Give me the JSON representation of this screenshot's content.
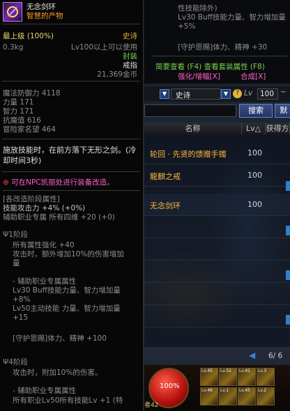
{
  "tooltip": {
    "item_name": "无念剑环",
    "item_subtitle": "智慧的产物",
    "grade_label": "最上级 (100%)",
    "rarity": "史诗",
    "weight": "0.3kg",
    "level_req": "Lv100以上可以使用",
    "sealed": "封装",
    "slot_type": "戒指",
    "price": "21,369金币",
    "stats": [
      {
        "label": "魔法防御力",
        "value": "4118"
      },
      {
        "label": "力量",
        "value": "171"
      },
      {
        "label": "智力",
        "value": "171"
      },
      {
        "label": "抗魔值",
        "value": "616"
      },
      {
        "label": "冒险家名望",
        "value": "464"
      }
    ],
    "skill_desc": "施放技能时，在前方落下无形之剑。(冷却时间3秒)",
    "upgrade_note": "可在NPC凯丽处进行装备改造。",
    "stage_header": "[各改造阶段属性]",
    "stage_line1": "技能攻击力 +4% (+0%)",
    "stage_line2": "辅助职业专属 所有四维 +20 (+0)",
    "tier1_title": "1阶段",
    "tier1_lines": [
      "所有属性强化 +40",
      "攻击时，额外增加10%的伤害增加",
      "量",
      "",
      "- 辅助职业专属属性",
      "Lv30 Buff技能力量、智力增加量",
      "+8%",
      "Lv50主动技能 力量、智力增加量",
      "+15",
      "",
      "[守护恩赐]体力、精神 +100"
    ],
    "tier4_title": "4阶段",
    "tier4_lines": [
      "攻击时，附加10%的伤害。",
      "",
      "- 辅助职业专属属性",
      "所有职业Lv50所有技能Lv +1 (特"
    ]
  },
  "compare_panel": {
    "lines": [
      "性技能除外)",
      "Lv30 Buff技能力量、智力增加量",
      "+5%",
      "",
      "[守护恩赐]体力、精神 +30"
    ],
    "link1": "简要查看 (F4) 查看套装属性 (F8)",
    "link2": "强化/增幅[X]",
    "link3": "合成[X]"
  },
  "filters": {
    "rarity_value": "史诗",
    "lv_label": "Lv",
    "lv_value": "100",
    "help": "?"
  },
  "search": {
    "button": "搜索",
    "button2": "默"
  },
  "table": {
    "headers": [
      "名称",
      "Lv△",
      "获得方"
    ],
    "rows": [
      {
        "name": "轮回 · 先贤的馈赠手镯",
        "lv": "100"
      },
      {
        "name": "龍麒之戒",
        "lv": "100"
      },
      {
        "name": "无念剑环",
        "lv": "100"
      },
      {
        "name": "",
        "lv": ""
      },
      {
        "name": "",
        "lv": ""
      },
      {
        "name": "",
        "lv": ""
      },
      {
        "name": "",
        "lv": ""
      },
      {
        "name": "",
        "lv": ""
      },
      {
        "name": "",
        "lv": ""
      }
    ]
  },
  "pager": {
    "text": "6/ 6"
  },
  "hud": {
    "hp": "100%",
    "slots": [
      "Lv.45",
      "Lv.52",
      "Lv.41",
      "Lv.3",
      "Lv.46",
      "Lv.1",
      "Lv.45",
      "Lv.2"
    ],
    "bottom_text": "者42"
  },
  "colors": {
    "gold": "#d8b233",
    "orange": "#ff9c2a",
    "green": "#7ad24a",
    "pink": "#ff5fc8",
    "accent": "#2f5bb0"
  }
}
